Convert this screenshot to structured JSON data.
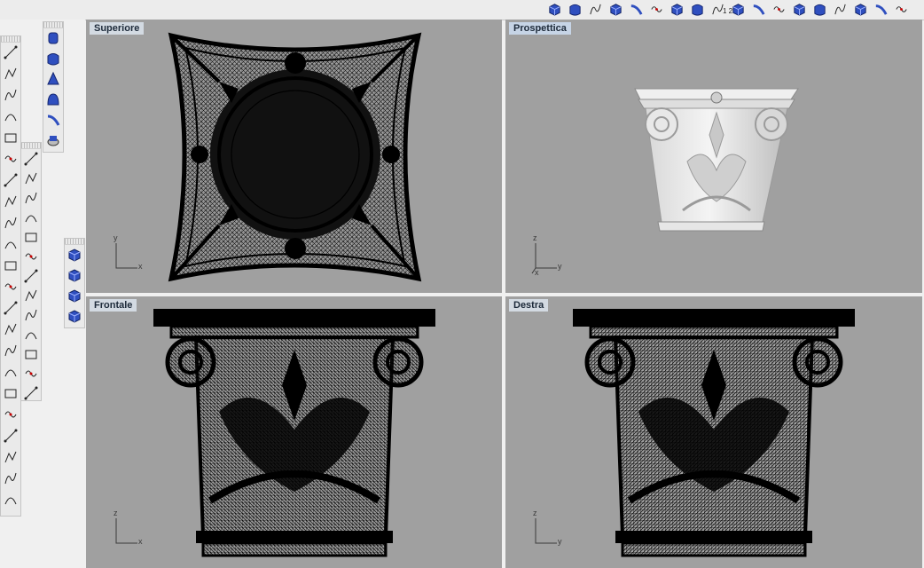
{
  "viewports": {
    "top": {
      "label": "Superiore",
      "axis_v": "y",
      "axis_h": "x"
    },
    "perspective": {
      "label": "Prospettica",
      "axis_v": "z",
      "axis_h": "y",
      "axis_side": "x"
    },
    "front": {
      "label": "Frontale",
      "axis_v": "z",
      "axis_h": "x"
    },
    "right": {
      "label": "Destra",
      "axis_v": "z",
      "axis_h": "y"
    }
  },
  "active_viewport": "perspective",
  "toolbar_top": {
    "icons": [
      "surface-from-points-icon",
      "box-edge-icon",
      "sphere-icon",
      "plane-surface-icon",
      "cylinder-solid-icon",
      "network-surface-icon",
      "loft-icon",
      "patch-icon",
      "revolve-icon",
      "blend-surface-icon",
      "pipe-icon",
      "arch-icon",
      "bounding-box-icon",
      "point-grid-icon",
      "extrude-surface-icon",
      "sweep-one-rail-icon",
      "sweep-two-rail-icon",
      "unroll-icon"
    ],
    "numbers": "1 2"
  },
  "left_palettes": {
    "primitives": [
      "ellipsoid-icon",
      "torus-icon",
      "cone-solid-icon",
      "circle-icon",
      "ellipse-icon",
      "polygon-icon"
    ],
    "solids": [
      "cylinder-icon",
      "capsule-icon",
      "pyramid-icon",
      "dome-icon",
      "pipe-solid-icon",
      "truncated-cone-icon"
    ],
    "curves": [
      "line-icon",
      "polyline-icon",
      "spline-icon",
      "arc-icon",
      "point-icon",
      "curve-through-points-icon",
      "interp-curve-icon",
      "free-curve-icon",
      "control-points-icon",
      "offset-icon",
      "fillet-curve-icon",
      "extend-icon",
      "blend-curve-icon",
      "split-icon",
      "explode-icon",
      "join-icon",
      "trim-icon",
      "rebuild-icon",
      "point-on-curve-icon",
      "divide-icon",
      "polygon-icon",
      "sphere-grid-icon"
    ],
    "rect_tools": [
      "rectangle-corner-icon",
      "rectangle-center-icon",
      "rectangle-3pt-icon",
      "rectangle-vertical-icon",
      "rounded-rectangle-icon",
      "arc-start-icon",
      "arc-center-icon",
      "arc-tangent-icon",
      "arc-3pt-icon",
      "extend-arc-icon",
      "arc-corner-icon",
      "offset-arc-icon",
      "circle-tangent-icon"
    ],
    "boxes": [
      "box-icon",
      "box-corner-icon",
      "box-3pt-icon",
      "box-height-icon"
    ]
  },
  "colors": {
    "viewport_bg": "#a0a0a0",
    "mesh": "#0a0a0a",
    "label_bg": "#d3dae2",
    "accent_blue": "#2f4fbf"
  }
}
